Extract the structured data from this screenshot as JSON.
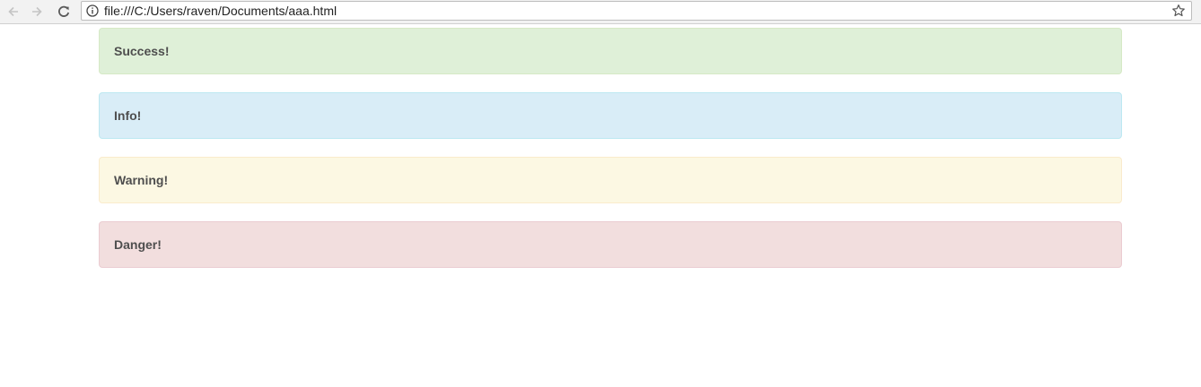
{
  "browser": {
    "url": "file:///C:/Users/raven/Documents/aaa.html",
    "icons": {
      "back": "arrow-left-icon",
      "forward": "arrow-right-icon",
      "reload": "reload-icon",
      "info": "info-icon",
      "bookmark": "star-icon"
    }
  },
  "alerts": [
    {
      "label": "Success!",
      "type": "success",
      "bg": "#dff0d8"
    },
    {
      "label": "Info!",
      "type": "info",
      "bg": "#d9edf7"
    },
    {
      "label": "Warning!",
      "type": "warning",
      "bg": "#fcf8e3"
    },
    {
      "label": "Danger!",
      "type": "danger",
      "bg": "#f2dede"
    }
  ]
}
